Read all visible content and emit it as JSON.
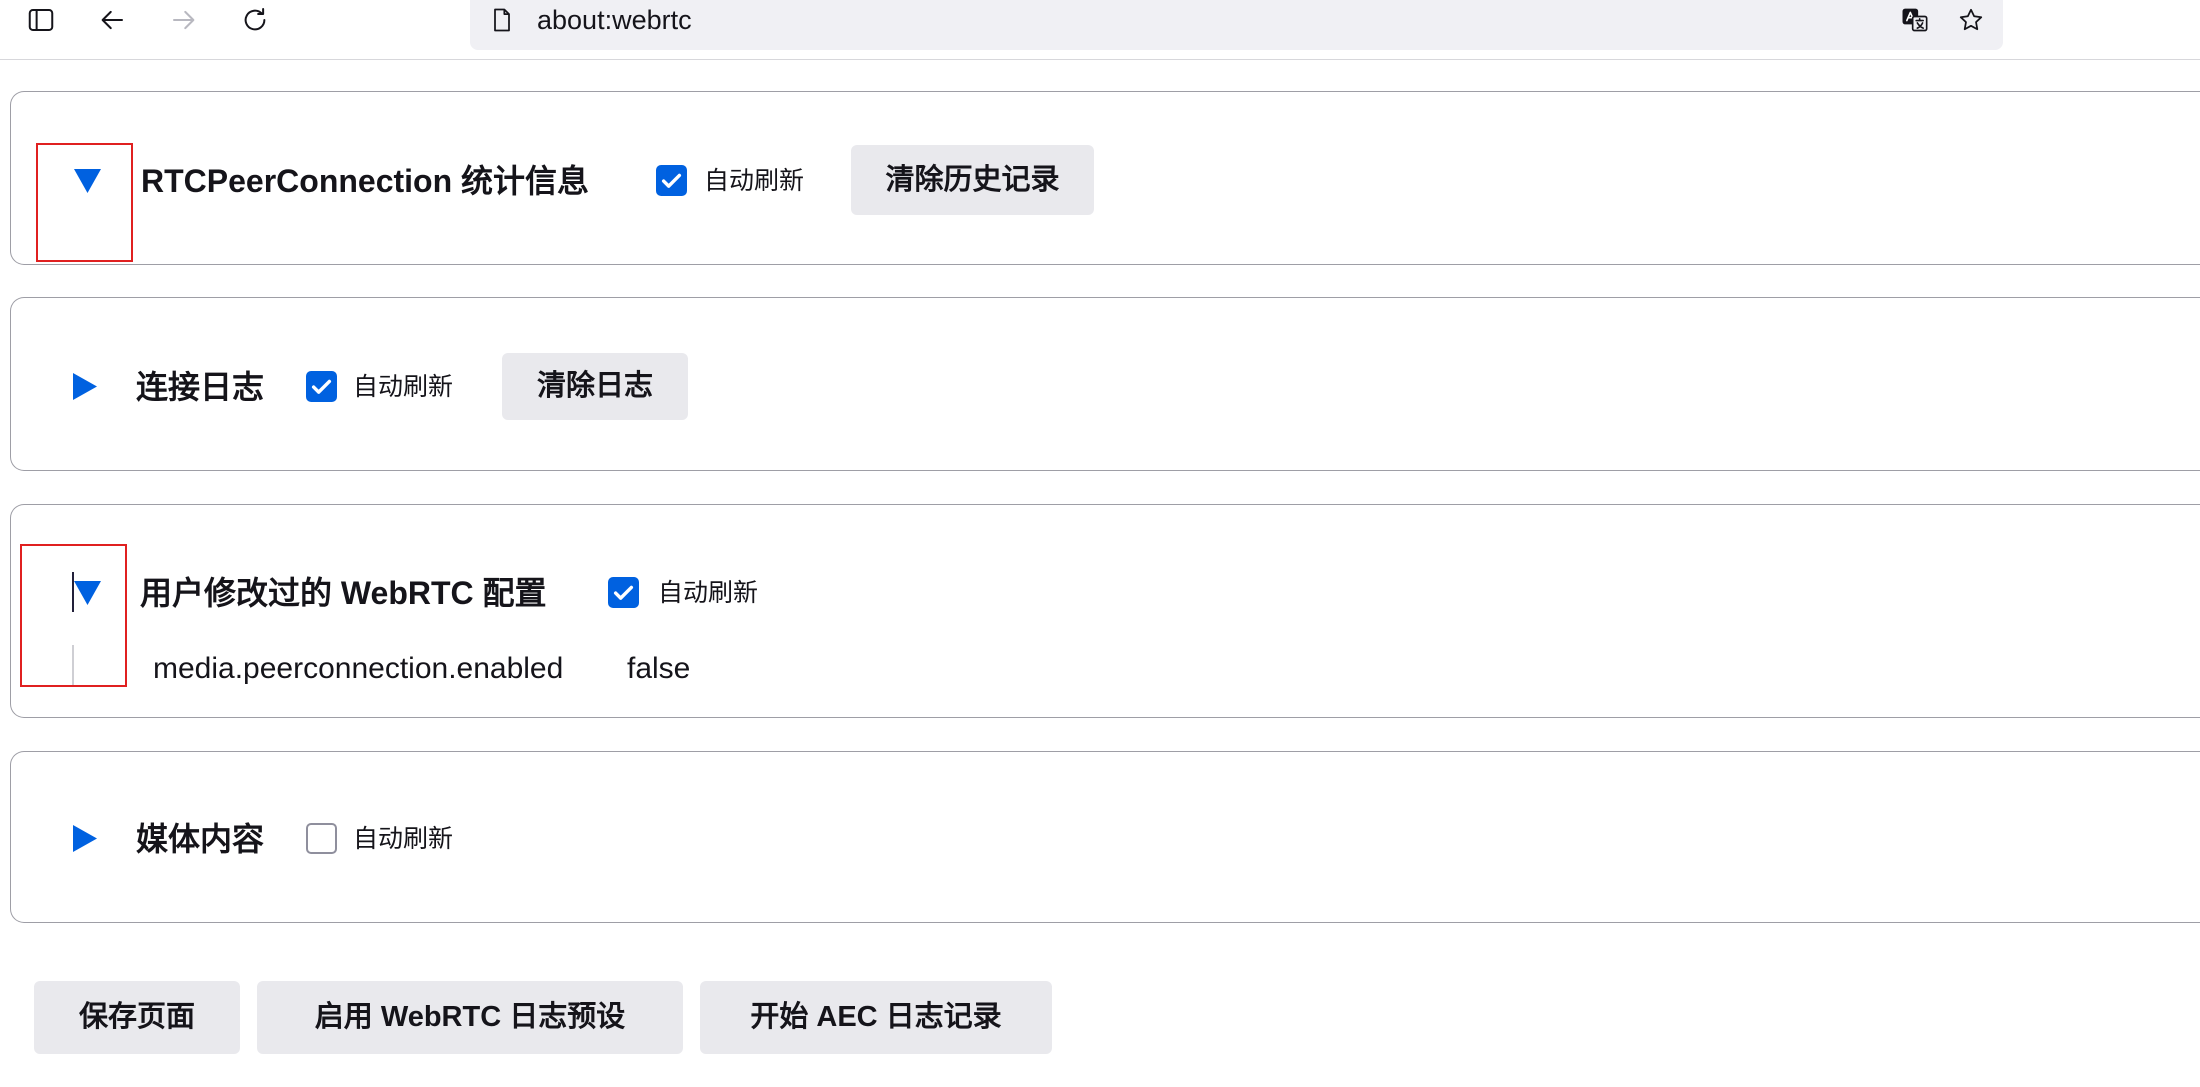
{
  "toolbar": {
    "sidebar_icon": "sidebar-icon",
    "back_icon": "back-arrow-icon",
    "forward_icon": "forward-arrow-icon",
    "forward_enabled": false,
    "reload_icon": "reload-icon",
    "page_icon": "page-icon",
    "url": "about:webrtc",
    "translate_icon": "translate-icon",
    "bookmark_icon": "star-icon"
  },
  "sections": [
    {
      "title": "RTCPeerConnection 统计信息",
      "expanded": true,
      "auto_refresh": {
        "label": "自动刷新",
        "checked": true
      },
      "button": "清除历史记录"
    },
    {
      "title": "连接日志",
      "expanded": false,
      "auto_refresh": {
        "label": "自动刷新",
        "checked": true
      },
      "button": "清除日志"
    },
    {
      "title": "用户修改过的 WebRTC 配置",
      "expanded": true,
      "auto_refresh": {
        "label": "自动刷新",
        "checked": true
      },
      "prefs": [
        {
          "name": "media.peerconnection.enabled",
          "value": "false"
        }
      ]
    },
    {
      "title": "媒体内容",
      "expanded": false,
      "auto_refresh": {
        "label": "自动刷新",
        "checked": false
      }
    }
  ],
  "footer_buttons": {
    "save_page": "保存页面",
    "enable_log_preset": "启用 WebRTC 日志预设",
    "start_aec_logging": "开始 AEC 日志记录"
  },
  "colors": {
    "accent": "#0061e0",
    "text": "#15141a",
    "button_bg": "#e9e9ed",
    "annotation_red": "#e02020",
    "section_border": "#9e9ea6"
  }
}
